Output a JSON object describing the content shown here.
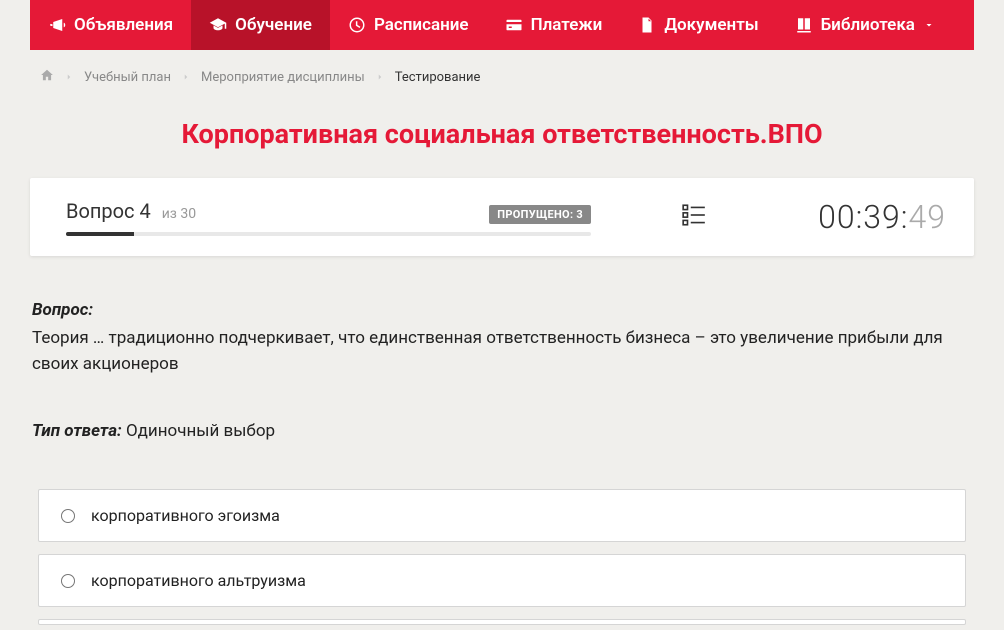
{
  "nav": {
    "items": [
      {
        "label": "Объявления",
        "icon": "megaphone"
      },
      {
        "label": "Обучение",
        "icon": "graduation",
        "active": true
      },
      {
        "label": "Расписание",
        "icon": "clock"
      },
      {
        "label": "Платежи",
        "icon": "card"
      },
      {
        "label": "Документы",
        "icon": "document"
      },
      {
        "label": "Библиотека",
        "icon": "book",
        "dropdown": true
      }
    ]
  },
  "breadcrumb": {
    "items": [
      {
        "label": "Учебный план"
      },
      {
        "label": "Мероприятие дисциплины"
      }
    ],
    "current": "Тестирование"
  },
  "page_title": "Корпоративная социальная ответственность.ВПО",
  "quiz": {
    "question_prefix": "Вопрос",
    "question_number": "4",
    "total_prefix": "из",
    "total": "30",
    "skipped_label": "ПРОПУЩЕНО: 3",
    "progress_percent": 13,
    "timer": {
      "mm": "00",
      "ss": "39",
      "cs": "49"
    }
  },
  "question": {
    "label": "Вопрос:",
    "text": "Теория … традиционно подчеркивает, что единственная ответственность бизнеса – это увеличение прибыли для своих акционеров",
    "answer_type_label": "Тип ответа:",
    "answer_type": "Одиночный выбор"
  },
  "options": [
    {
      "text": "корпоративного эгоизма"
    },
    {
      "text": "корпоративного альтруизма"
    }
  ]
}
